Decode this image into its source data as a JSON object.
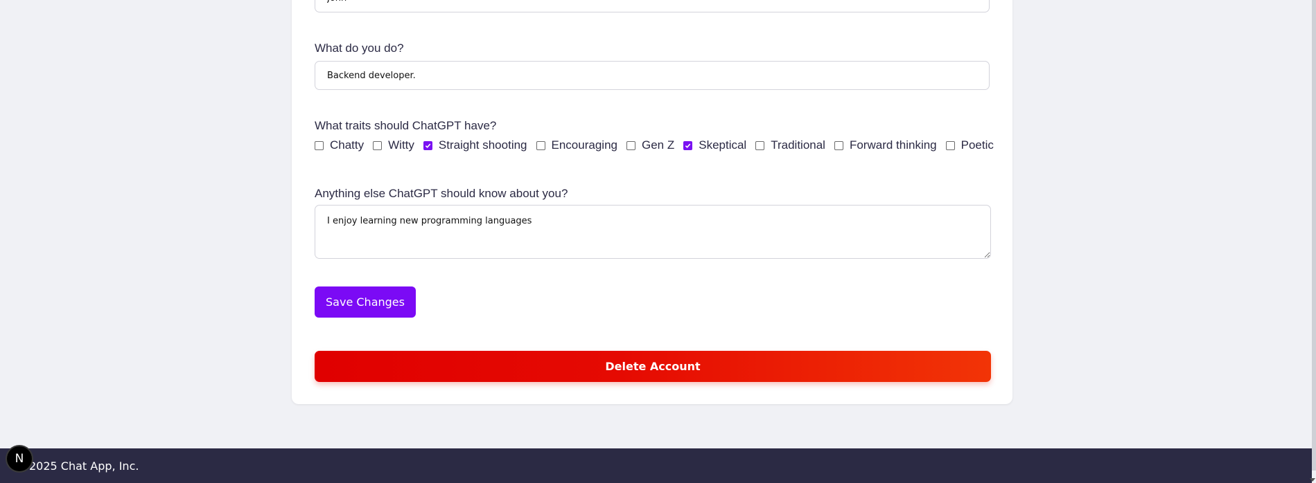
{
  "form": {
    "name_value": "John",
    "occupation_label": "What do you do?",
    "occupation_value": "Backend developer.",
    "traits_label": "What traits should ChatGPT have?",
    "traits": [
      {
        "label": "Chatty",
        "checked": false
      },
      {
        "label": "Witty",
        "checked": false
      },
      {
        "label": "Straight shooting",
        "checked": true
      },
      {
        "label": "Encouraging",
        "checked": false
      },
      {
        "label": "Gen Z",
        "checked": false
      },
      {
        "label": "Skeptical",
        "checked": true
      },
      {
        "label": "Traditional",
        "checked": false
      },
      {
        "label": "Forward thinking",
        "checked": false
      },
      {
        "label": "Poetic",
        "checked": false
      }
    ],
    "about_label": "Anything else ChatGPT should know about you?",
    "about_value": "I enjoy learning new programming languages",
    "save_label": "Save Changes",
    "delete_label": "Delete Account"
  },
  "footer": {
    "text": "2025 Chat App, Inc.",
    "badge_letter": "N"
  },
  "colors": {
    "accent": "#7b0af5",
    "danger_start": "#e00000",
    "danger_end": "#f23406",
    "footer_bg": "#2b2a44",
    "page_bg": "#f0f1f5"
  }
}
